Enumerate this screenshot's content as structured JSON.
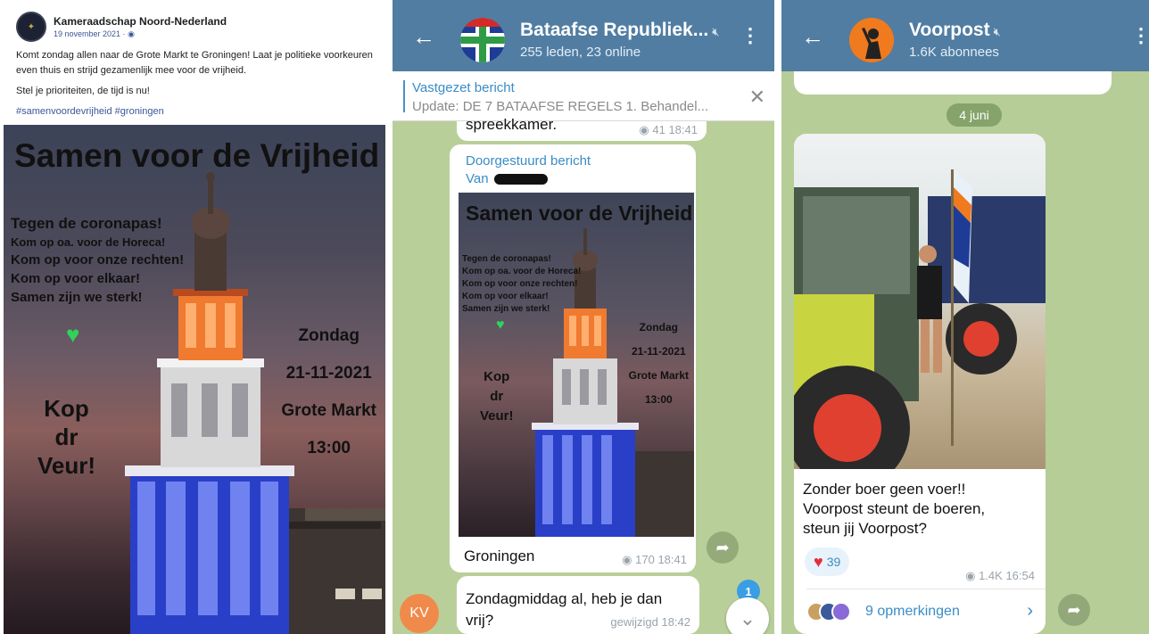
{
  "facebook": {
    "page_name": "Kameraadschap Noord-Nederland",
    "date": "19 november 2021 · ",
    "globe_icon": "globe-icon",
    "paragraph1": "Komt zondag allen naar de Grote Markt te Groningen! Laat je politieke voorkeuren even thuis en strijd gezamenlijk mee voor de vrijheid.",
    "paragraph2": "Stel je prioriteiten, de tijd is nu!",
    "hashtags": "#samenvoordevrijheid #groningen",
    "poster": {
      "title": "Samen voor de Vrijheid",
      "line1": "Tegen de coronapas!",
      "line2": "Kom op oa. voor de Horeca!",
      "line3": "Kom op voor onze rechten!",
      "line4": "Kom op voor elkaar!",
      "line5": "Samen zijn we sterk!",
      "day": "Zondag",
      "date": "21-11-2021",
      "place": "Grote Markt",
      "time": "13:00",
      "slogan1": "Kop",
      "slogan2": "dr",
      "slogan3": "Veur!"
    }
  },
  "telegram_group": {
    "title": "Bataafse Republiek...",
    "subtitle": "255 leden, 23 online",
    "pinned_title": "Vastgezet bericht",
    "pinned_text": "Update: DE 7 BATAAFSE REGELS  1. Behandel...",
    "prev_msg_text": "spreekkamer.",
    "prev_msg_views": "41",
    "prev_msg_time": "18:41",
    "forwarded_label": "Doorgestuurd bericht",
    "forwarded_from": "Van",
    "caption": "Groningen",
    "views": "170",
    "time": "18:41",
    "reply_avatar": "KV",
    "reply_text_line1": "Zondagmiddag al, heb je dan",
    "reply_text_line2": "vrij?",
    "reply_meta": "gewijzigd 18:42",
    "unread_count": "1"
  },
  "telegram_channel": {
    "title": "Voorpost",
    "subtitle": "1.6K abonnees",
    "date_pill": "4 juni",
    "caption_line1": "Zonder boer geen voer!!",
    "caption_line2": "Voorpost steunt de boeren,",
    "caption_line3": "steun jij Voorpost?",
    "reaction_count": "39",
    "views": "1.4K",
    "time": "16:54",
    "comments_label": "9 opmerkingen"
  },
  "colors": {
    "telegram_header": "#517da2",
    "telegram_link": "#3a8cc6",
    "facebook_link": "#385898",
    "heart_green": "#2fd35a",
    "reaction_red": "#e0303a"
  }
}
